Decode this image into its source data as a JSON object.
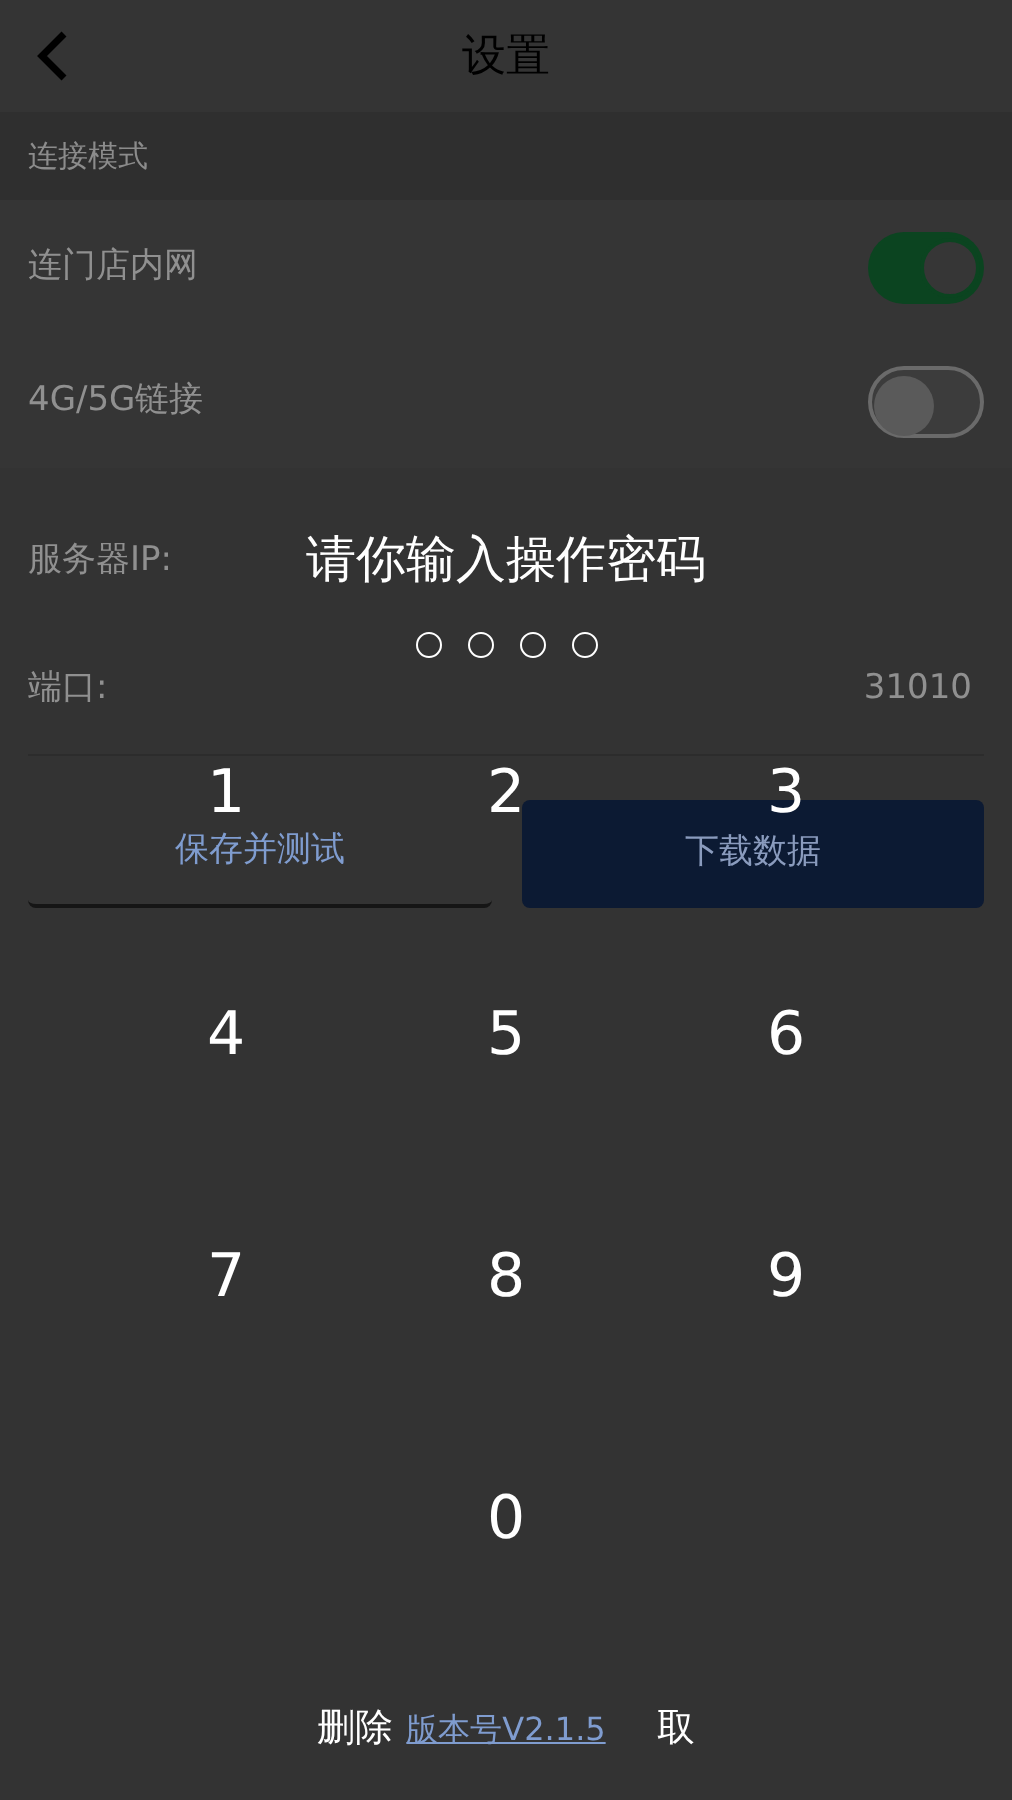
{
  "header": {
    "title": "设置"
  },
  "section": "连接模式",
  "toggles": [
    {
      "label": "连门店内网",
      "on": true
    },
    {
      "label": "4G/5G链接",
      "on": false
    }
  ],
  "fields": [
    {
      "label": "服务器IP:"
    },
    {
      "label": "端口:",
      "value": "31010"
    }
  ],
  "buttons": [
    {
      "label": "保存并测试",
      "kind": "outline"
    },
    {
      "label": "下载数据",
      "kind": "filled"
    }
  ],
  "version": "版本号V2.1.5",
  "passcode": {
    "title": "请你输入操作密码",
    "dots": [
      {
        "filled": false
      },
      {
        "filled": false
      },
      {
        "filled": false
      },
      {
        "filled": false
      }
    ],
    "keys": [
      "1",
      "2",
      "3",
      "4",
      "5",
      "6",
      "7",
      "8",
      "9",
      "0"
    ],
    "delete": "删除",
    "cancel": "取"
  }
}
